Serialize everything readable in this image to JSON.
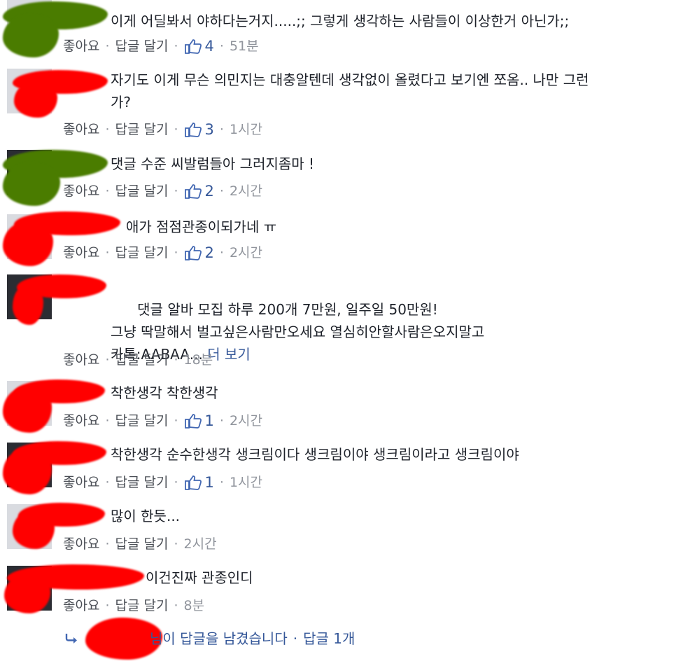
{
  "actions": {
    "like": "좋아요",
    "reply": "답글 달기",
    "separator": "·"
  },
  "comments": [
    {
      "text": "이게 어딜봐서 야하다는거지.....;; 그렇게 생각하는 사람들이 이상한거 아닌가;;",
      "likes": "4",
      "time": "51분"
    },
    {
      "text": "자기도 이게 무슨 의민지는 대충알텐데 생각없이 올렸다고 보기엔 쪼옴.. 나만 그런\n가?",
      "likes": "3",
      "time": "1시간"
    },
    {
      "text": "댓글 수준 씨발럼들아 그러지좀마 !",
      "likes": "2",
      "time": "2시간"
    },
    {
      "text": "애가 점점관종이되가네 ㅠ",
      "likes": "2",
      "time": "2시간"
    },
    {
      "text": "댓글 알바 모집 하루 200개 7만원, 일주일 50만원!\n그냥 딱말해서 벌고싶은사람만오세요 열심히안할사람은오지말고\n카톡:AABAA...",
      "more": "더 보기",
      "likes": "",
      "time": "18분"
    },
    {
      "text": "착한생각 착한생각",
      "likes": "1",
      "time": "2시간"
    },
    {
      "text": "착한생각 순수한생각 생크림이다 생크림이야 생크림이라고 생크림이야",
      "likes": "1",
      "time": "1시간"
    },
    {
      "text": "많이 한듯...",
      "likes": "",
      "time": "2시간"
    },
    {
      "text": "이건진짜 관종인디",
      "likes": "",
      "time": "8분"
    }
  ],
  "reply_summary": {
    "text": "님이 답글을 남겼습니다",
    "separator": "·",
    "count": "답글 1개"
  },
  "colors": {
    "link": "#365899",
    "meta": "#90949c",
    "text": "#1d2129",
    "scribble_red": "#ff0000",
    "scribble_green": "#4a7c00"
  }
}
